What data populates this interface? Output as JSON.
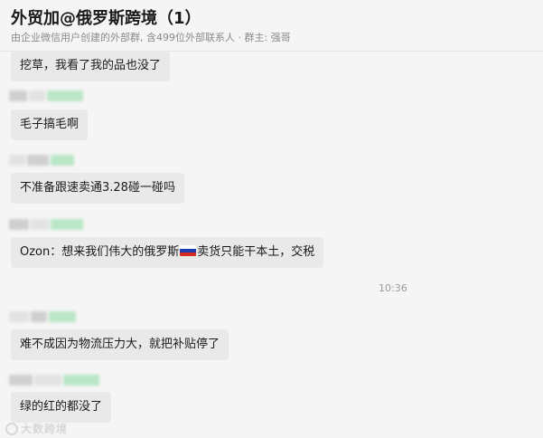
{
  "header": {
    "title": "外贸加@俄罗斯跨境（1）",
    "subtitle": "由企业微信用户创建的外部群, 含499位外部联系人 · 群主: 强哥"
  },
  "messages": [
    {
      "text": "挖草，我看了我的品也没了"
    },
    {
      "text": "毛子搞毛啊"
    },
    {
      "text": "不准备跟速卖通3.28碰一碰吗"
    },
    {
      "text_before_flag": "Ozon：想来我们伟大的俄罗斯",
      "flag_icon": "russia-flag-icon",
      "text_after_flag": "卖货只能干本土，交税"
    },
    {
      "text": "难不成因为物流压力大，就把补贴停了"
    },
    {
      "text": "绿的红的都没了"
    }
  ],
  "time_divider": "10:36",
  "watermark": "大数跨境",
  "colors": {
    "bubble_bg": "#e9e9e9",
    "background": "#f5f5f5",
    "flag_white": "#ffffff",
    "flag_blue": "#1c3fb5",
    "flag_red": "#d52b1e"
  }
}
